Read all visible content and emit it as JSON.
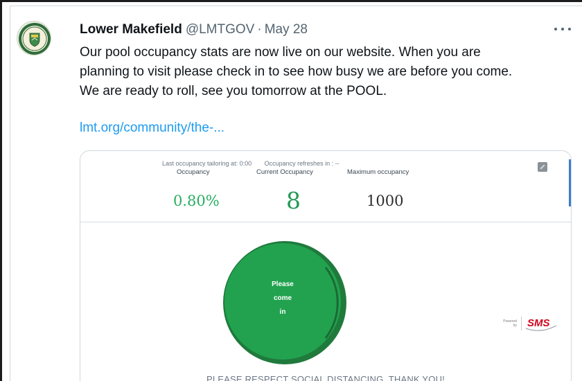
{
  "tweet": {
    "display_name": "Lower Makefield",
    "handle": "@LMTGOV",
    "separator": "·",
    "date": "May 28",
    "text_lines": [
      "Our pool occupancy stats are now live on our website. When you are",
      "planning to visit please check in to see how busy we are before you come.",
      "We are ready to roll, see you tomorrow at the POOL."
    ],
    "link_text": "lmt.org/community/the-..."
  },
  "card": {
    "last_tailoring": "Last occupancy tailoring at: 0:00",
    "refresh_text": "Occupancy refreshes in : --",
    "labels": {
      "occupancy": "Occupancy",
      "current": "Current Occupancy",
      "maximum": "Maximum occupancy"
    },
    "values": {
      "occupancy_pct": "0.80%",
      "current": "8",
      "maximum": "1000"
    },
    "status_lines": [
      "Please",
      "come",
      "in"
    ],
    "powered_by": "Powered by",
    "sms_brand": "SMS",
    "footer": "PLEASE RESPECT SOCIAL DISTANCING. THANK YOU!"
  },
  "colors": {
    "accent_link": "#1d9bf0",
    "status_green": "#27ae60",
    "status_circle": "#22a24f",
    "brand_red": "#d0021b"
  },
  "icons": {
    "more": "more-horizontal-icon",
    "expand": "expand-icon",
    "avatar": "township-seal-logo"
  }
}
